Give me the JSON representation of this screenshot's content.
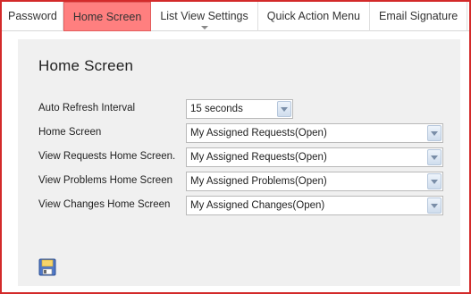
{
  "tabs": [
    {
      "label": "Password"
    },
    {
      "label": "Home Screen"
    },
    {
      "label": "List View Settings"
    },
    {
      "label": "Quick Action Menu"
    },
    {
      "label": "Email Signature"
    }
  ],
  "page": {
    "title": "Home Screen"
  },
  "form": {
    "auto_refresh": {
      "label": "Auto Refresh Interval",
      "value": "15 seconds"
    },
    "home_screen": {
      "label": "Home Screen",
      "value": "My Assigned Requests(Open)"
    },
    "requests_home": {
      "label": "View Requests Home Screen.",
      "value": "My Assigned Requests(Open)"
    },
    "problems_home": {
      "label": "View Problems Home Screen",
      "value": "My Assigned Problems(Open)"
    },
    "changes_home": {
      "label": "View Changes Home Screen",
      "value": "My Assigned Changes(Open)"
    }
  },
  "colors": {
    "frame_border": "#d32a2a",
    "active_tab": "#ff7f7f",
    "panel_bg": "#f0f0f0"
  },
  "icons": {
    "save": "floppy-disk-icon",
    "dropdown": "chevron-down-icon"
  }
}
